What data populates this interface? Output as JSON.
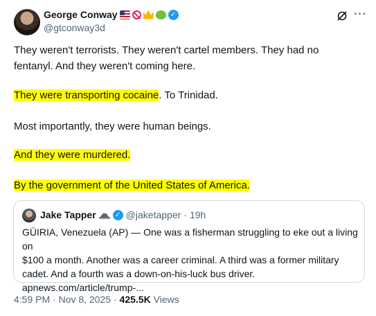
{
  "author": {
    "name": "George Conway",
    "handle": "@gtconway3d",
    "badges": [
      "us-flag-icon",
      "no-entry-icon",
      "crown-icon",
      "frog-icon",
      "verified-badge-icon"
    ]
  },
  "post": {
    "line1a": "They weren't terrorists. They weren't cartel members. They had no",
    "line1b": "fentanyl. And they weren't coming here.",
    "line2_highlight": "They were transporting cocaine",
    "line2_rest": ". To Trinidad.",
    "line3": "Most importantly, they were human beings.",
    "line4": "And they were murdered.",
    "line5": "By the government of the United States of America."
  },
  "quote": {
    "name": "Jake Tapper",
    "handle": "@jaketapper",
    "separator": "·",
    "age": "19h",
    "text": "GÜIRIA, Venezuela (AP) — One was a fisherman struggling to eke out a living on\n$100 a month. Another was a career criminal. A third was a former military\ncadet. And a fourth was a down-on-his-luck bus driver.\napnews.com/article/trump-..."
  },
  "footer": {
    "timestamp": "4:59 PM · Nov 8, 2025 · ",
    "views_count": "425.5K",
    "views_label": " Views"
  },
  "colors": {
    "highlight": "#ffff00",
    "verified": "#1d9bf0",
    "secondary_text": "#536471"
  }
}
